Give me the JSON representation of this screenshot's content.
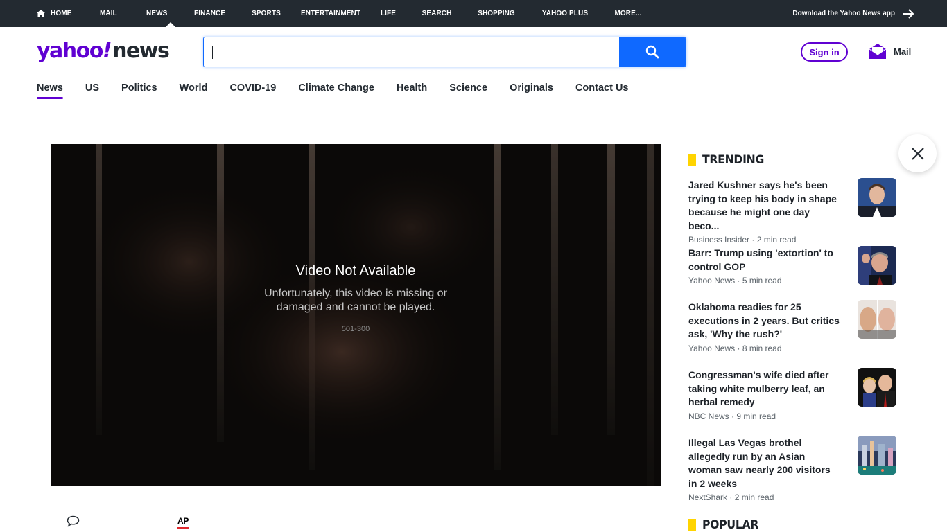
{
  "topnav": {
    "items": [
      {
        "label": "Home",
        "icon": "home-icon"
      },
      {
        "label": "Mail"
      },
      {
        "label": "News"
      },
      {
        "label": "Finance"
      },
      {
        "label": "Sports"
      },
      {
        "label": "Entertainment"
      },
      {
        "label": "Life"
      },
      {
        "label": "Search"
      },
      {
        "label": "Shopping"
      },
      {
        "label": "Yahoo Plus"
      },
      {
        "label": "More..."
      }
    ],
    "active_index": 2,
    "download_label": "Download the Yahoo News app"
  },
  "header": {
    "logo_yahoo": "yahoo",
    "logo_bang": "!",
    "logo_news": "news",
    "search_value": "",
    "search_placeholder": "",
    "signin_label": "Sign in",
    "mail_label": "Mail"
  },
  "subnav": {
    "items": [
      "News",
      "US",
      "Politics",
      "World",
      "COVID-19",
      "Climate Change",
      "Health",
      "Science",
      "Originals",
      "Contact Us"
    ],
    "active_index": 0
  },
  "video": {
    "title": "Video Not Available",
    "desc_line1": "Unfortunately, this video is missing or",
    "desc_line2": "damaged and cannot be played.",
    "code": "501-300"
  },
  "article_meta": {
    "source_logo": "AP"
  },
  "trending": {
    "heading": "TRENDING",
    "items": [
      {
        "title": "Jared Kushner says he's been trying to keep his body in shape because he might one day beco...",
        "source": "Business Insider",
        "read": "2 min read"
      },
      {
        "title": "Barr: Trump using 'extortion' to control GOP",
        "source": "Yahoo News",
        "read": "5 min read"
      },
      {
        "title": "Oklahoma readies for 25 executions in 2 years. But critics ask, 'Why the rush?'",
        "source": "Yahoo News",
        "read": "8 min read"
      },
      {
        "title": "Congressman's wife died after taking white mulberry leaf, an herbal remedy",
        "source": "NBC News",
        "read": "9 min read"
      },
      {
        "title": "Illegal Las Vegas brothel allegedly run by an Asian woman saw nearly 200 visitors in 2 weeks",
        "source": "NextShark",
        "read": "2 min read"
      }
    ]
  },
  "popular": {
    "heading": "POPULAR"
  },
  "colors": {
    "brand_purple": "#6001d2",
    "topbar": "#232a31",
    "search_blue": "#0f69ff",
    "accent_yellow": "#ffd400"
  }
}
